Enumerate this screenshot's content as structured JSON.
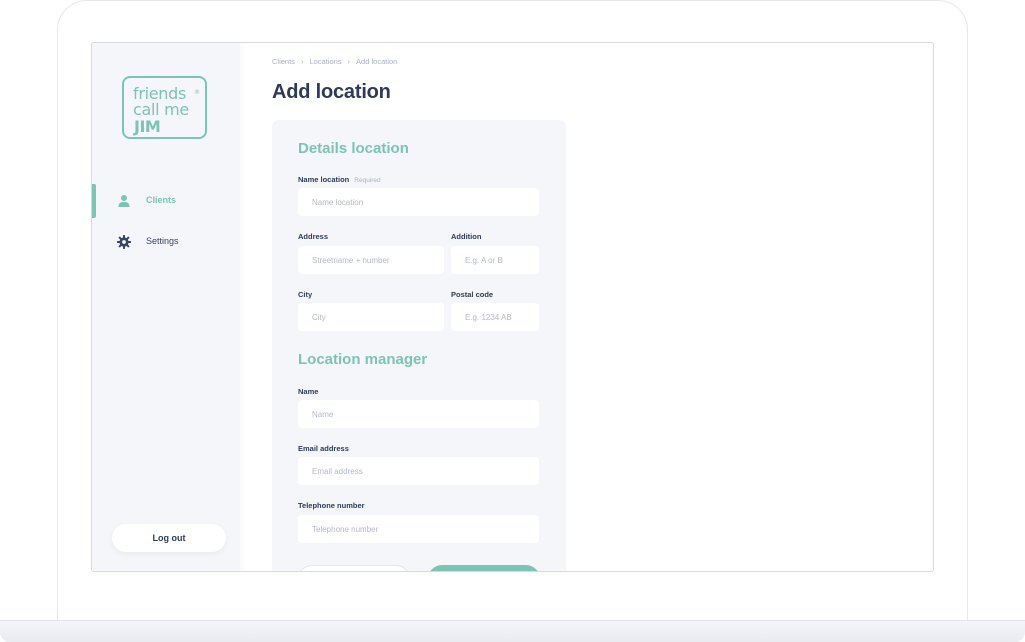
{
  "brand": {
    "logo_line1": "friends",
    "logo_line2": "call me",
    "logo_line3": "JIM",
    "logo_registered": "®",
    "accent_color": "#7cc4b4",
    "text_color": "#2f3a5a"
  },
  "sidebar": {
    "items": [
      {
        "label": "Clients",
        "icon": "user-icon",
        "active": true
      },
      {
        "label": "Settings",
        "icon": "gear-icon",
        "active": false
      }
    ],
    "logout_label": "Log out"
  },
  "breadcrumb": [
    "Clients",
    "Locations",
    "Add location"
  ],
  "page_title": "Add location",
  "form": {
    "details_title": "Details location",
    "name_location": {
      "label": "Name location",
      "required": "Required",
      "placeholder": "Name location",
      "value": ""
    },
    "address": {
      "label": "Address",
      "placeholder": "Streetname + number",
      "value": ""
    },
    "addition": {
      "label": "Addition",
      "placeholder": "E.g. A or B",
      "value": ""
    },
    "city": {
      "label": "City",
      "placeholder": "City",
      "value": ""
    },
    "postal_code": {
      "label": "Postal code",
      "placeholder": "E.g. 1234 AB",
      "value": ""
    },
    "manager_title": "Location manager",
    "name": {
      "label": "Name",
      "placeholder": "Name",
      "value": ""
    },
    "email": {
      "label": "Email address",
      "placeholder": "Email address",
      "value": ""
    },
    "telephone": {
      "label": "Telephone number",
      "placeholder": "Telephone number",
      "value": ""
    }
  }
}
